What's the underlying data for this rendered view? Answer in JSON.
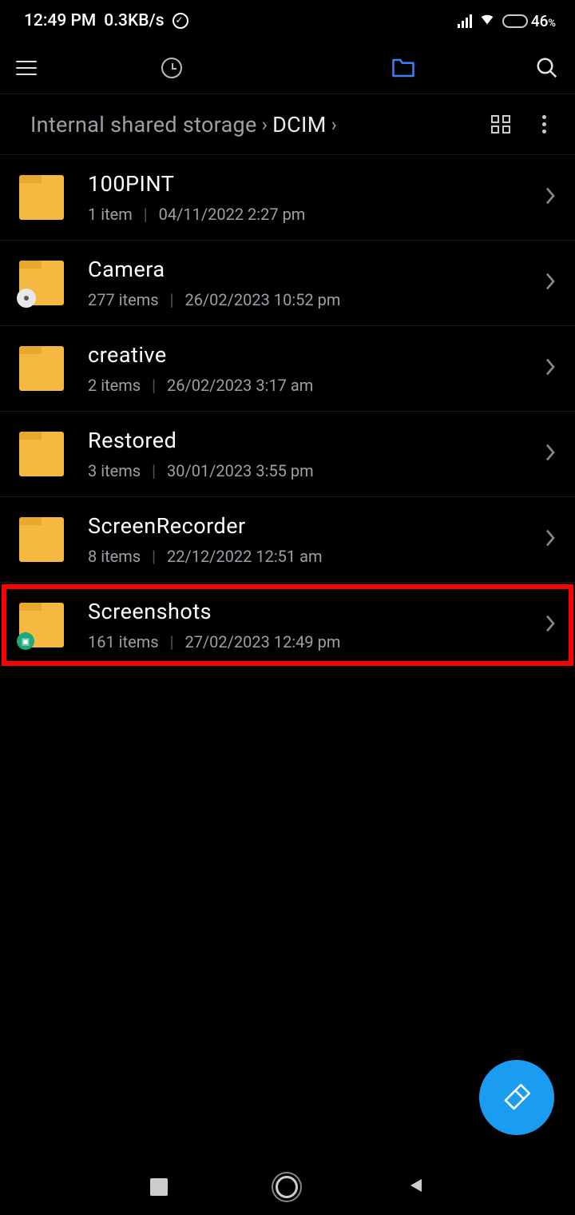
{
  "status": {
    "time": "12:49 PM",
    "net": "0.3KB/s",
    "battery_pct": "46",
    "battery_suffix": "%"
  },
  "breadcrumb": {
    "part1": "Internal shared storage",
    "part2": "DCIM"
  },
  "folders": [
    {
      "name": "100PINT",
      "count": "1 item",
      "date": "04/11/2022 2:27 pm"
    },
    {
      "name": "Camera",
      "count": "277 items",
      "date": "26/02/2023 10:52 pm"
    },
    {
      "name": "creative",
      "count": "2 items",
      "date": "26/02/2023 3:17 am"
    },
    {
      "name": "Restored",
      "count": "3 items",
      "date": "30/01/2023 3:55 pm"
    },
    {
      "name": "ScreenRecorder",
      "count": "8 items",
      "date": "22/12/2022 12:51 am"
    },
    {
      "name": "Screenshots",
      "count": "161 items",
      "date": "27/02/2023 12:49 pm"
    }
  ]
}
